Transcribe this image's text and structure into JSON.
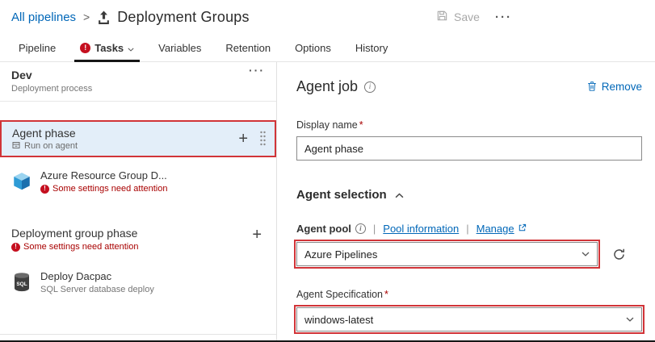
{
  "header": {
    "breadcrumb": "All pipelines",
    "separator": ">",
    "title": "Deployment Groups",
    "save_label": "Save"
  },
  "glyphs": {
    "ellipsis": "···",
    "plus": "+",
    "pipe": "|",
    "required": "*"
  },
  "tabs": [
    {
      "label": "Pipeline"
    },
    {
      "label": "Tasks"
    },
    {
      "label": "Variables"
    },
    {
      "label": "Retention"
    },
    {
      "label": "Options"
    },
    {
      "label": "History"
    }
  ],
  "sidebar": {
    "process": {
      "title": "Dev",
      "subtitle": "Deployment process"
    },
    "agent_phase": {
      "title": "Agent phase",
      "subtitle": "Run on agent"
    },
    "arg_task": {
      "title": "Azure Resource Group D...",
      "warning": "Some settings need attention"
    },
    "dg_phase": {
      "title": "Deployment group phase",
      "warning": "Some settings need attention"
    },
    "dacpac": {
      "title": "Deploy Dacpac",
      "subtitle": "SQL Server database deploy",
      "icon_label": "SQL"
    }
  },
  "panel": {
    "title": "Agent job",
    "remove_label": "Remove",
    "display_name": {
      "label": "Display name",
      "value": "Agent phase"
    },
    "agent_selection": {
      "title": "Agent selection"
    },
    "agent_pool": {
      "label": "Agent pool",
      "link_pool_info": "Pool information",
      "link_manage": "Manage",
      "value": "Azure Pipelines"
    },
    "agent_spec": {
      "label": "Agent Specification",
      "value": "windows-latest"
    }
  },
  "colors": {
    "link_blue": "#0067b8",
    "error_text": "#a80000",
    "error_badge": "#c50f1f",
    "annotation_red": "#d13438",
    "selected_row_bg": "#e3eef9"
  }
}
